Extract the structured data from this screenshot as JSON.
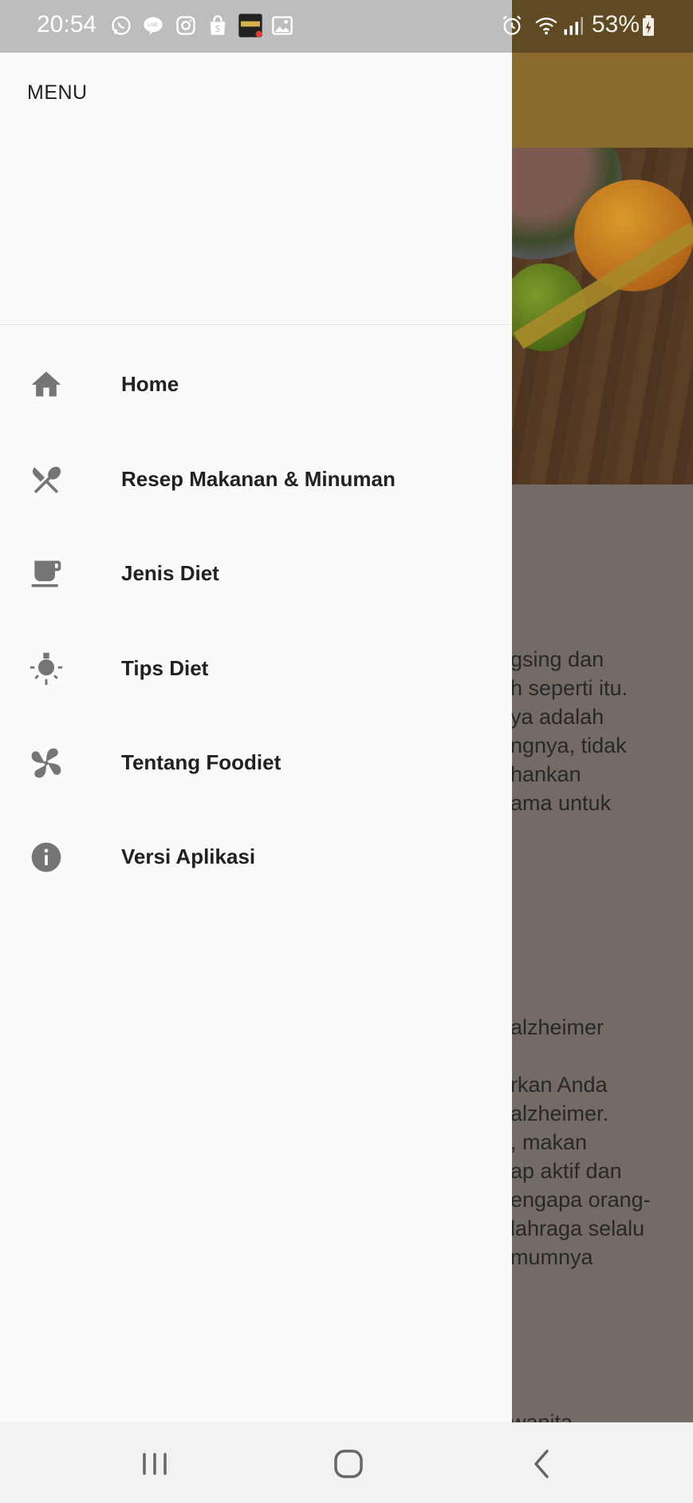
{
  "status_bar": {
    "time": "20:54",
    "battery_percent": "53%",
    "left_icons": [
      "whatsapp-icon",
      "line-icon",
      "instagram-icon",
      "shopee-icon",
      "game-icon",
      "gallery-icon"
    ],
    "right_icons": [
      "alarm-icon",
      "wifi-icon",
      "signal-icon",
      "battery-charging-icon"
    ]
  },
  "drawer": {
    "title": "MENU",
    "items": [
      {
        "label": "Home",
        "icon": "home-icon"
      },
      {
        "label": "Resep Makanan & Minuman",
        "icon": "utensils-icon"
      },
      {
        "label": "Jenis Diet",
        "icon": "coffee-cup-icon"
      },
      {
        "label": "Tips Diet",
        "icon": "lightbulb-icon"
      },
      {
        "label": "Tentang Foodiet",
        "icon": "pinwheel-icon"
      },
      {
        "label": "Versi Aplikasi",
        "icon": "info-icon"
      }
    ]
  },
  "background": {
    "paragraph1": [
      "gsing dan",
      "h seperti itu.",
      "ya adalah",
      "ngnya, tidak",
      "hankan",
      "ama untuk"
    ],
    "paragraph2": [
      "alzheimer"
    ],
    "paragraph3": [
      "rkan Anda",
      "alzheimer.",
      ", makan",
      "ap aktif dan",
      "engapa orang-",
      "lahraga selalu",
      "mumnya"
    ],
    "paragraph4": [
      "wanita"
    ]
  },
  "nav_bar": {
    "buttons": [
      "recent-apps-icon",
      "home-button-icon",
      "back-icon"
    ]
  },
  "colors": {
    "drawer_bg": "#fafafa",
    "app_bar": "#8a6a2e",
    "scrim_body": "#726b66",
    "icon_gray": "#757575"
  }
}
